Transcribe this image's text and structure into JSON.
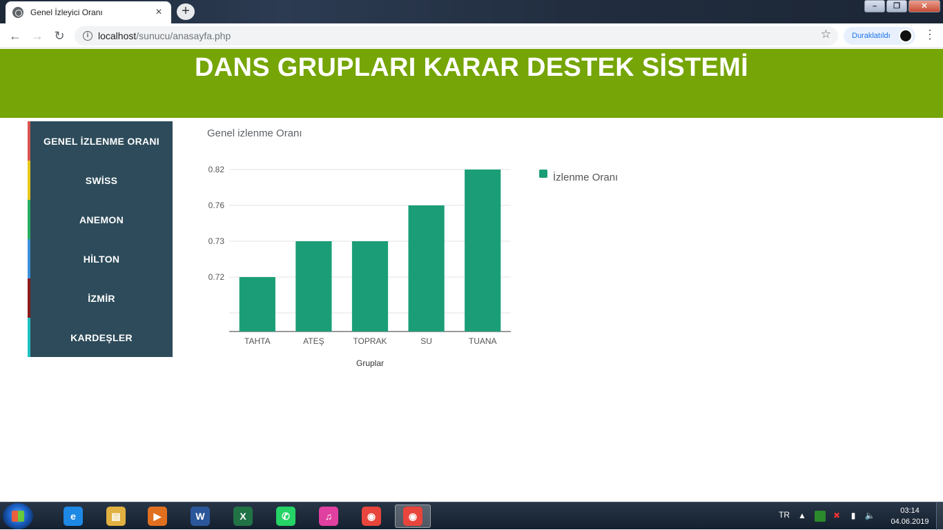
{
  "browser": {
    "tab_title": "Genel İzleyici Oranı",
    "tab_close": "×",
    "new_tab": "+",
    "url_host": "localhost",
    "url_path": "/sunucu/anasayfa.php",
    "paused_label": "Duraklatıldı",
    "back": "←",
    "forward": "→",
    "reload": "↻",
    "star": "☆",
    "menu": "⋮",
    "win_min": "–",
    "win_max": "❐",
    "win_close": "✕"
  },
  "page": {
    "banner_title": "DANS GRUPLARI KARAR DESTEK SİSTEMİ",
    "chart_title": "Genel izlenme Oranı",
    "sidebar": [
      {
        "label": "GENEL İZLENME ORANI",
        "color": "#d9534f"
      },
      {
        "label": "SWİSS",
        "color": "#e6c619"
      },
      {
        "label": "ANEMON",
        "color": "#27ae60"
      },
      {
        "label": "HİLTON",
        "color": "#3b8fd9"
      },
      {
        "label": "İZMİR",
        "color": "#8b1a1a"
      },
      {
        "label": "KARDEŞLER",
        "color": "#1fc2c2"
      }
    ]
  },
  "chart_data": {
    "type": "bar",
    "categories": [
      "TAHTA",
      "ATEŞ",
      "TOPRAK",
      "SU",
      "TUANA"
    ],
    "series": [
      {
        "name": "İzlenme Oranı",
        "values": [
          0.72,
          0.73,
          0.73,
          0.76,
          0.82
        ],
        "color": "#1b9e77"
      }
    ],
    "yticks": [
      "0.82",
      "0.76",
      "0.73",
      "0.72"
    ],
    "xlabel": "Gruplar",
    "ylabel": "",
    "legend": "right",
    "grid": true
  },
  "taskbar": {
    "apps": [
      {
        "name": "internet-explorer",
        "glyph": "e",
        "color": "#1e88e5"
      },
      {
        "name": "file-explorer",
        "glyph": "▤",
        "color": "#e0b040"
      },
      {
        "name": "media-player",
        "glyph": "▶",
        "color": "#e07020"
      },
      {
        "name": "word",
        "glyph": "W",
        "color": "#2b579a"
      },
      {
        "name": "excel",
        "glyph": "X",
        "color": "#217346"
      },
      {
        "name": "whatsapp",
        "glyph": "✆",
        "color": "#25d366"
      },
      {
        "name": "itunes",
        "glyph": "♫",
        "color": "#e040a0"
      },
      {
        "name": "chrome",
        "glyph": "◉",
        "color": "#e8453c"
      },
      {
        "name": "chrome-active",
        "glyph": "◉",
        "color": "#e8453c"
      }
    ],
    "lang": "TR",
    "time": "03:14",
    "date": "04.06.2019"
  }
}
